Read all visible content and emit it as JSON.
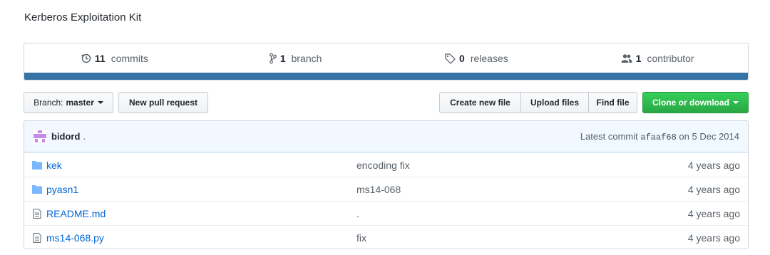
{
  "repo": {
    "description": "Kerberos Exploitation Kit"
  },
  "summary": {
    "commits": {
      "num": "11",
      "label": "commits",
      "icon": "history-icon"
    },
    "branches": {
      "num": "1",
      "label": "branch",
      "icon": "git-branch-icon"
    },
    "releases": {
      "num": "0",
      "label": "releases",
      "icon": "tag-icon"
    },
    "contributors": {
      "num": "1",
      "label": "contributor",
      "icon": "people-icon"
    },
    "language_color": "#3572A5"
  },
  "toolbar": {
    "branch_prefix": "Branch:",
    "branch_name": "master",
    "new_pr": "New pull request",
    "create_file": "Create new file",
    "upload_files": "Upload files",
    "find_file": "Find file",
    "clone": "Clone or download",
    "clone_color": "#28a745"
  },
  "latest_commit": {
    "author": "bidord",
    "message": ".",
    "prefix": "Latest commit",
    "sha": "afaaf68",
    "date": "on 5 Dec 2014"
  },
  "files": [
    {
      "type": "folder",
      "icon": "folder-icon",
      "name": "kek",
      "message": "encoding fix",
      "age": "4 years ago"
    },
    {
      "type": "folder",
      "icon": "folder-icon",
      "name": "pyasn1",
      "message": "ms14-068",
      "age": "4 years ago"
    },
    {
      "type": "file",
      "icon": "file-text-icon",
      "name": "README.md",
      "message": ".",
      "age": "4 years ago"
    },
    {
      "type": "file",
      "icon": "file-text-icon",
      "name": "ms14-068.py",
      "message": "fix",
      "age": "4 years ago"
    }
  ]
}
